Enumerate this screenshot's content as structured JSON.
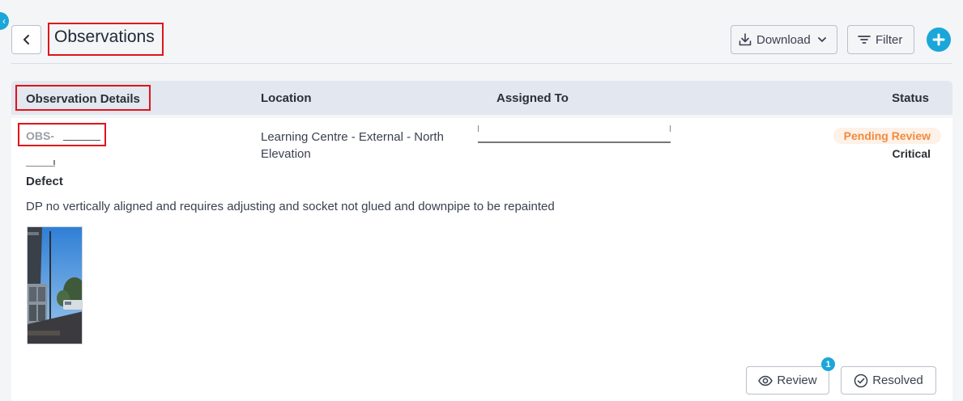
{
  "corner_badge": {
    "icon": "chevron-left-icon",
    "glyph": "‹"
  },
  "header": {
    "title": "Observations",
    "back_icon": "chevron-left-icon",
    "download_label": "Download",
    "filter_label": "Filter",
    "add_icon": "plus-icon"
  },
  "table": {
    "columns": [
      "Observation Details",
      "Location",
      "Assigned To",
      "Status"
    ],
    "rows": [
      {
        "id_prefix": "OBS-",
        "category": "Defect",
        "description": "DP no vertically aligned and requires adjusting and socket not glued and downpipe to be repainted",
        "location": "Learning Centre - External - North Elevation",
        "status": "Pending Review",
        "severity": "Critical",
        "review_label": "Review",
        "review_count": "1",
        "resolved_label": "Resolved"
      }
    ]
  },
  "colors": {
    "accent": "#1ba6d9",
    "highlight_border": "#e0141a",
    "status_pending_text": "#f28b3c",
    "status_pending_bg": "#fdf1e8",
    "header_row_bg": "#e3e7ef"
  }
}
